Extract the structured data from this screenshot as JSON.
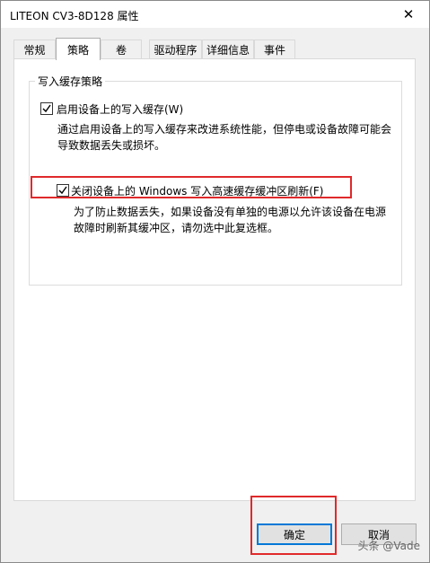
{
  "window": {
    "title": "LITEON CV3-8D128 属性",
    "close_label": "✕"
  },
  "tabs": [
    {
      "label": "常规"
    },
    {
      "label": "策略",
      "selected": true
    },
    {
      "label": "卷"
    },
    {
      "label": "驱动程序"
    },
    {
      "label": "详细信息"
    },
    {
      "label": "事件"
    }
  ],
  "write_cache_policy": {
    "group_label": "写入缓存策略",
    "enable_write_cache": {
      "label": "启用设备上的写入缓存(W)",
      "checked": true,
      "desc_line1": "通过启用设备上的写入缓存来改进系统性能，但停电或设备故障可能会",
      "desc_line2": "导致数据丢失或损坏。"
    },
    "disable_flush": {
      "label": "关闭设备上的 Windows 写入高速缓存缓冲区刷新(F)",
      "checked": true,
      "desc_line1": "为了防止数据丢失，如果设备没有单独的电源以允许该设备在电源",
      "desc_line2": "故障时刷新其缓冲区，请勿选中此复选框。"
    }
  },
  "buttons": {
    "ok": "确定",
    "cancel": "取消"
  },
  "watermark": "头条 @Vade",
  "colors": {
    "highlight": "#e0292b",
    "focus": "#0078d7"
  }
}
